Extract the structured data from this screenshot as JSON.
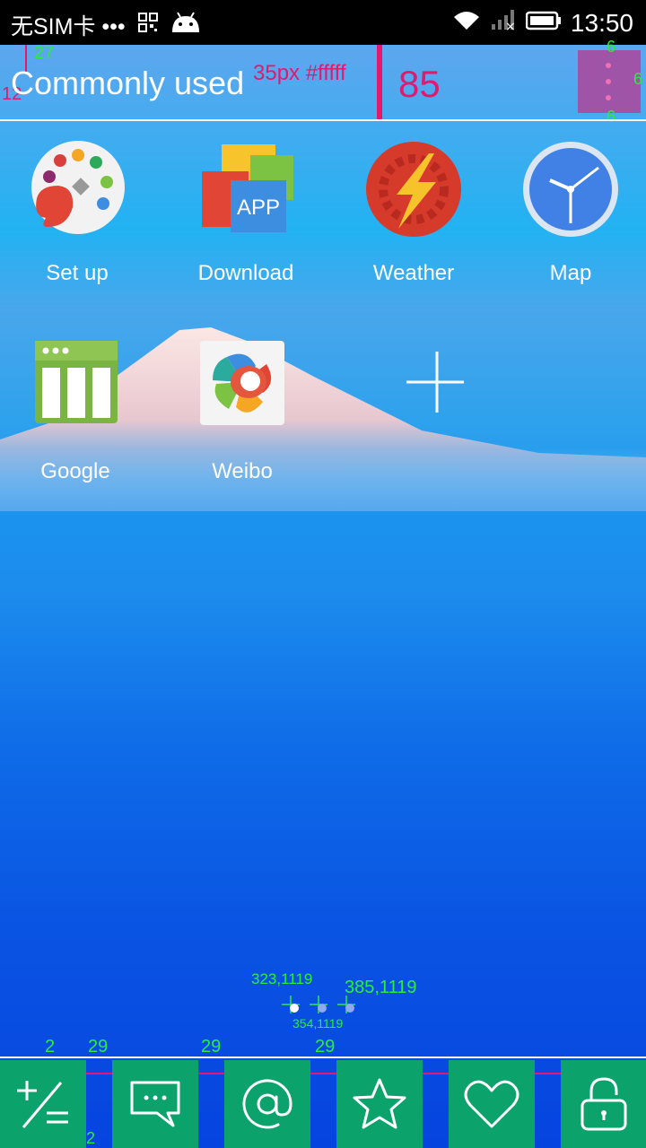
{
  "status_bar": {
    "carrier": "无SIM卡 •••",
    "time": "13:50"
  },
  "header": {
    "title": "Commonly used"
  },
  "annotations": {
    "font_spec": "35px #fffff",
    "header_height": "85",
    "top_margin": "27",
    "left_margin": "12",
    "menu_top": "6",
    "menu_right": "6",
    "menu_bottom": "6",
    "dot1_coord": "323,1119",
    "dot2_coord": "354,1119",
    "dot3_coord": "385,1119",
    "gap_a": "2",
    "gap_b": "29",
    "gap_c": "29",
    "gap_d": "29",
    "gap_e": "2"
  },
  "apps": [
    {
      "label": "Set up",
      "icon": "palette-icon"
    },
    {
      "label": "Download",
      "icon": "app-store-icon"
    },
    {
      "label": "Weather",
      "icon": "lightning-icon"
    },
    {
      "label": "Map",
      "icon": "clock-icon"
    },
    {
      "label": "Google",
      "icon": "columns-icon"
    },
    {
      "label": "Weibo",
      "icon": "pinwheel-icon"
    },
    {
      "label": "",
      "icon": "add-icon"
    }
  ],
  "icon_text": {
    "download": "APP"
  },
  "pager": {
    "count": 3,
    "active": 1
  },
  "bottom_bar": {
    "buttons": [
      "calculator-icon",
      "message-icon",
      "at-icon",
      "star-icon",
      "heart-icon",
      "lock-icon"
    ]
  },
  "colors": {
    "accent": "#0ca26c",
    "annotation_pink": "#e5176f",
    "annotation_green": "#27ee3c",
    "menu_box": "#a054a8"
  }
}
